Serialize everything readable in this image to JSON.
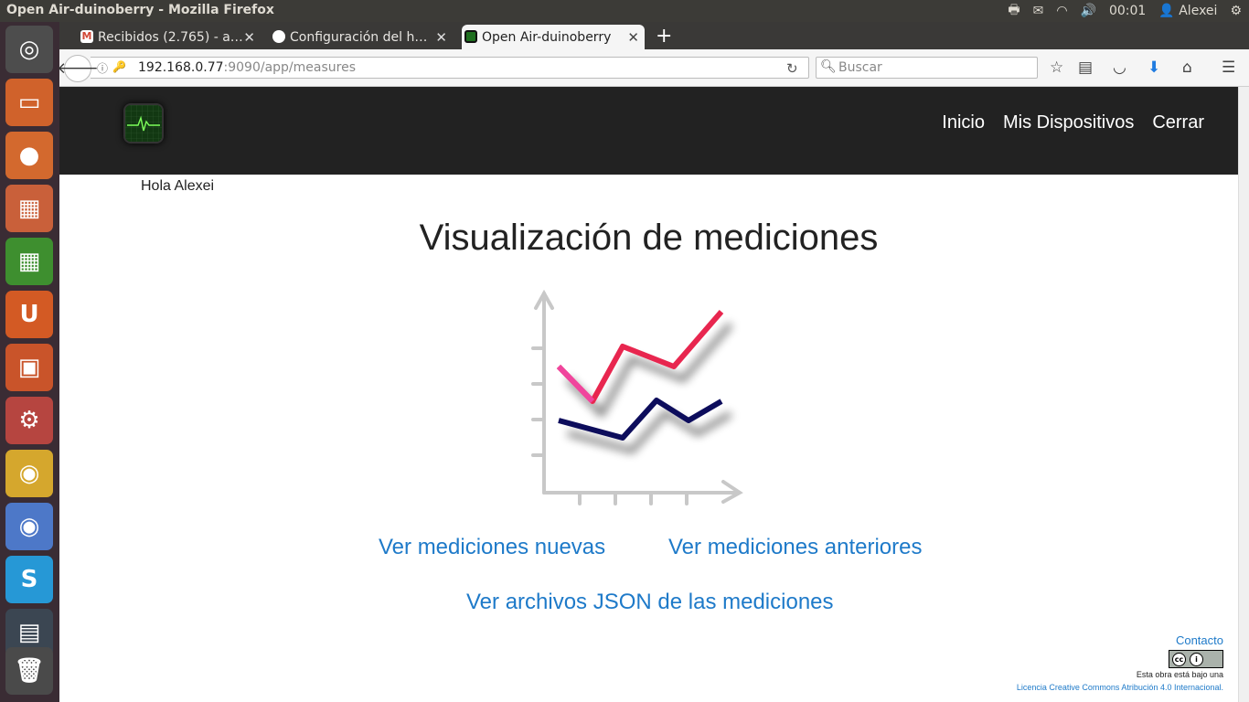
{
  "window": {
    "title": "Open Air-duinoberry - Mozilla Firefox"
  },
  "tray": {
    "time": "00:01",
    "user": "Alexei"
  },
  "launcher": {
    "items": [
      {
        "name": "dash-home",
        "glyph": "◎",
        "bg": "#4d4d4d"
      },
      {
        "name": "files",
        "glyph": "▭",
        "bg": "#d0622b"
      },
      {
        "name": "firefox",
        "glyph": "●",
        "bg": "#d3692e"
      },
      {
        "name": "libreoffice-impress",
        "glyph": "▦",
        "bg": "#c9603a"
      },
      {
        "name": "libreoffice-calc",
        "glyph": "▦",
        "bg": "#3e8f2f"
      },
      {
        "name": "ubuntu-one",
        "glyph": "U",
        "bg": "#d35a24"
      },
      {
        "name": "software-center",
        "glyph": "▣",
        "bg": "#c9542a"
      },
      {
        "name": "system-settings",
        "glyph": "⚙",
        "bg": "#b64540"
      },
      {
        "name": "chrome",
        "glyph": "◉",
        "bg": "#d5a72d"
      },
      {
        "name": "chromium",
        "glyph": "◉",
        "bg": "#4d78c8"
      },
      {
        "name": "skype",
        "glyph": "S",
        "bg": "#2698d6"
      },
      {
        "name": "document-viewer",
        "glyph": "▤",
        "bg": "#3b4652"
      },
      {
        "name": "trash",
        "glyph": "🗑",
        "bg": "#4a4a4a"
      }
    ]
  },
  "tabs": [
    {
      "label": "Recibidos (2.765) - a…",
      "icon_color": "#d14836"
    },
    {
      "label": "Configuración del h…",
      "icon_color": "#ffffff"
    },
    {
      "label": "Open Air-duinoberry",
      "icon_color": "#1f6f1f"
    }
  ],
  "navbar": {
    "url_host": "192.168.0.77",
    "url_rest": ":9090/app/measures",
    "search_placeholder": "Buscar"
  },
  "site": {
    "nav": [
      "Inicio",
      "Mis Dispositivos",
      "Cerrar"
    ],
    "greeting": "Hola Alexei",
    "title": "Visualización de mediciones",
    "links": {
      "new": "Ver mediciones nuevas",
      "old": "Ver mediciones anteriores",
      "json": "Ver archivos JSON de las mediciones"
    },
    "footer": {
      "contact": "Contacto",
      "text": "Esta obra está bajo una",
      "license": "Licencia Creative Commons Atribución 4.0 Internacional."
    }
  },
  "colors": {
    "brand_link": "#1e7ac9",
    "nav_bg": "#222222",
    "line_pink": "#f0449d",
    "line_red": "#e8284f",
    "line_navy": "#0d0b5c"
  }
}
